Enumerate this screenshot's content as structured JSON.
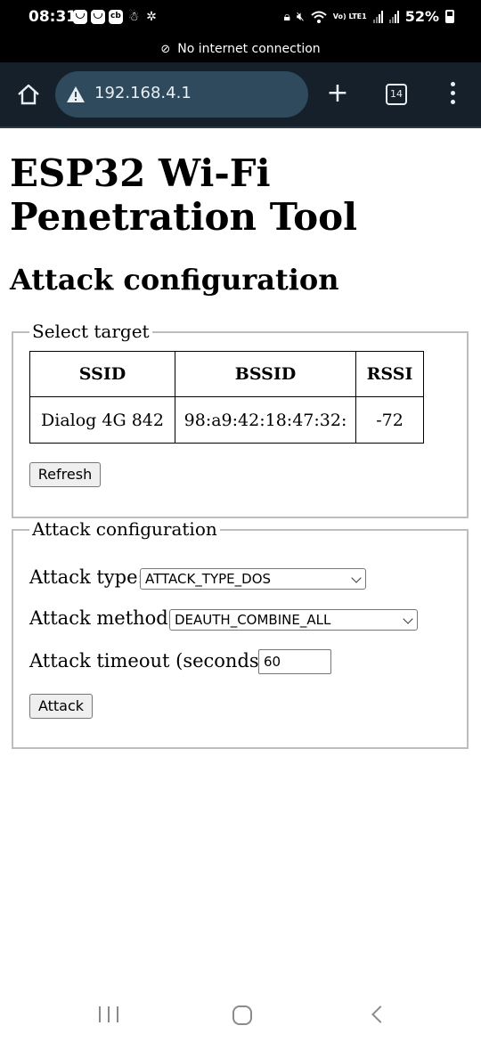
{
  "status_bar": {
    "time": "08:31",
    "network_type": "Vo) LTE1",
    "battery": "52%"
  },
  "offline_banner": {
    "text": "No internet connection"
  },
  "browser": {
    "url": "192.168.4.1",
    "tab_count": "14",
    "colors": {
      "toolbar_bg": "#15202b",
      "urlbar_bg": "#2e4a5c"
    }
  },
  "page": {
    "title": "ESP32 Wi-Fi Penetration Tool",
    "section_heading": "Attack configuration",
    "target_fieldset": {
      "legend": "Select target",
      "table": {
        "headers": [
          "SSID",
          "BSSID",
          "RSSI"
        ],
        "rows": [
          [
            "Dialog 4G 842",
            "98:a9:42:18:47:32:",
            "-72"
          ]
        ]
      },
      "refresh_label": "Refresh"
    },
    "attack_fieldset": {
      "legend": "Attack configuration",
      "attack_type_label": "Attack type:",
      "attack_type_value": "ATTACK_TYPE_DOS",
      "attack_method_label": "Attack method:",
      "attack_method_value": "DEAUTH_COMBINE_ALL",
      "timeout_label": "Attack timeout (seconds):",
      "timeout_value": "60",
      "attack_label": "Attack"
    }
  }
}
